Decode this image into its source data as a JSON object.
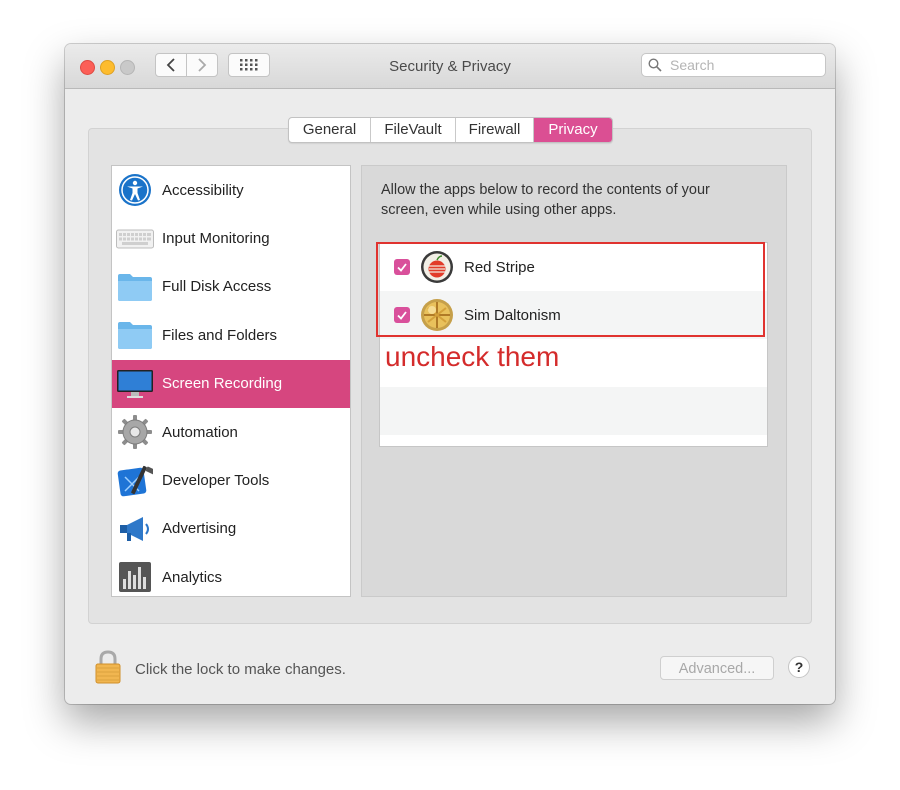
{
  "window": {
    "title": "Security & Privacy"
  },
  "search": {
    "placeholder": "Search"
  },
  "tabs": [
    {
      "label": "General"
    },
    {
      "label": "FileVault"
    },
    {
      "label": "Firewall"
    },
    {
      "label": "Privacy",
      "active": true
    }
  ],
  "sidebar": {
    "items": [
      {
        "label": "Accessibility",
        "icon": "accessibility-icon"
      },
      {
        "label": "Input Monitoring",
        "icon": "keyboard-icon"
      },
      {
        "label": "Full Disk Access",
        "icon": "folder-icon"
      },
      {
        "label": "Files and Folders",
        "icon": "folder-icon"
      },
      {
        "label": "Screen Recording",
        "icon": "display-icon",
        "selected": true
      },
      {
        "label": "Automation",
        "icon": "gear-icon"
      },
      {
        "label": "Developer Tools",
        "icon": "xcode-icon"
      },
      {
        "label": "Advertising",
        "icon": "megaphone-icon"
      },
      {
        "label": "Analytics",
        "icon": "bar-chart-icon"
      }
    ]
  },
  "main": {
    "description": "Allow the apps below to record the contents of your screen, even while using other apps.",
    "apps": [
      {
        "name": "Red Stripe",
        "checked": true,
        "icon": "red-stripe-app-icon"
      },
      {
        "name": "Sim Daltonism",
        "checked": true,
        "icon": "sim-daltonism-app-icon"
      }
    ],
    "annotation": "uncheck them"
  },
  "footer": {
    "lock_text": "Click the lock to make changes.",
    "advanced_label": "Advanced...",
    "help_label": "?"
  },
  "colors": {
    "accent": "#d6467f",
    "annotation": "#e0332f"
  }
}
